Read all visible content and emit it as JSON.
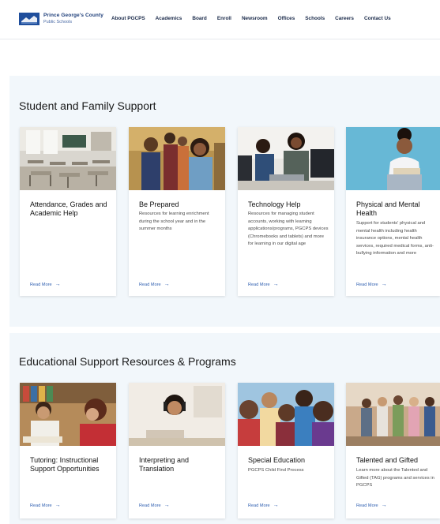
{
  "header": {
    "logo_line1": "Prince George's County",
    "logo_line2": "Public Schools",
    "nav": [
      "About PGCPS",
      "Academics",
      "Board",
      "Enroll",
      "Newsroom",
      "Offices",
      "Schools",
      "Careers",
      "Contact Us"
    ]
  },
  "section1": {
    "title": "Student and Family Support",
    "cards": [
      {
        "title": "Attendance, Grades and Academic Help",
        "desc": "",
        "read_more": "Read More",
        "image": "empty-classroom-photo"
      },
      {
        "title": "Be Prepared",
        "desc": "Resources for learning enrichment during the school year and in the summer months",
        "read_more": "Read More",
        "image": "students-group-photo"
      },
      {
        "title": "Technology Help",
        "desc": "Resources for managing student accounts, working with learning applications/programs, PGCPS devices (Chromebooks and tablets) and more for learning in our digital age",
        "read_more": "Read More",
        "image": "students-computers-photo"
      },
      {
        "title": "Physical and Mental Health",
        "desc": "Support for students' physical and mental health including health insurance options, mental health services, required medical forms, anti-bullying information and more",
        "read_more": "Read More",
        "image": "student-reading-photo"
      }
    ]
  },
  "section2": {
    "title": "Educational Support Resources & Programs",
    "cards": [
      {
        "title": "Tutoring: Instructional Support Opportunities",
        "desc": "",
        "read_more": "Read More",
        "image": "tutoring-photo"
      },
      {
        "title": "Interpreting and Translation",
        "desc": "",
        "read_more": "Read More",
        "image": "headphones-student-photo"
      },
      {
        "title": "Special Education",
        "desc": "PGCPS Child Find Process",
        "read_more": "Read More",
        "image": "children-smiling-photo"
      },
      {
        "title": "Talented and Gifted",
        "desc": "Learn more about the Talented and Gifted (TAG) programs and services in PGCPS",
        "read_more": "Read More",
        "image": "students-backpacks-photo"
      }
    ]
  },
  "colors": {
    "accent": "#2f5fb0",
    "brand": "#1f4e9c",
    "band": "#f2f7fb"
  }
}
